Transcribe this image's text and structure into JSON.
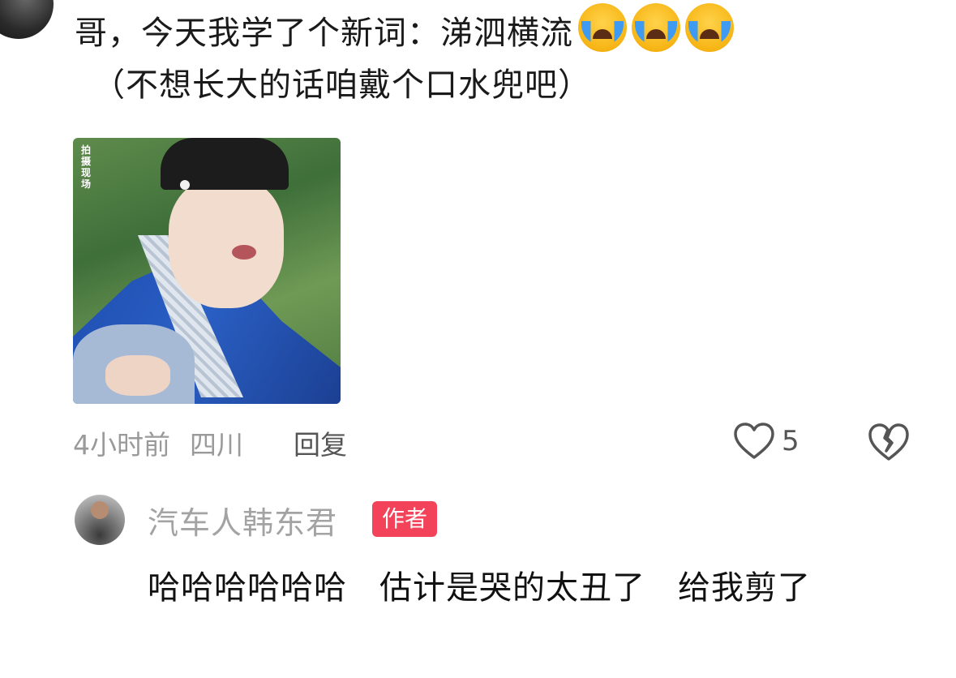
{
  "comment": {
    "text_line1": "哥，今天我学了个新词：涕泗横流",
    "emojis": [
      "crying-face",
      "crying-face",
      "crying-face"
    ],
    "text_line2": "（不想长大的话咱戴个口水兜吧）",
    "image_watermark": "拍摄现场",
    "time": "4小时前",
    "region": "四川",
    "reply_label": "回复",
    "like_count": "5"
  },
  "reply": {
    "username": "汽车人韩东君",
    "badge": "作者",
    "text_part1": "哈哈哈哈哈哈",
    "text_part2": "估计是哭的太丑了",
    "text_part3": "给我剪了"
  },
  "colors": {
    "badge": "#f2435a",
    "meta_text": "#9a9a9a",
    "body_text": "#1a1a1a"
  }
}
